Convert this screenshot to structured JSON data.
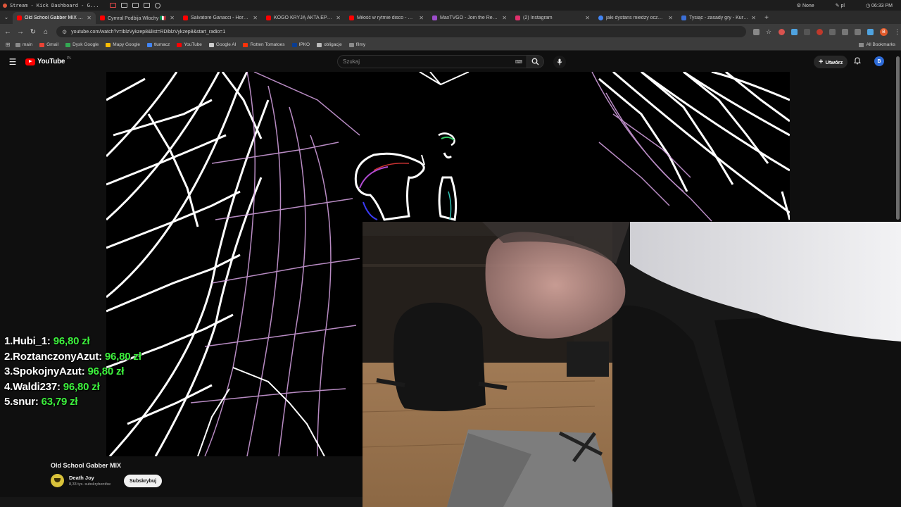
{
  "os": {
    "window_title": "Stream - Kick Dashboard - G...",
    "status_none": "None",
    "keyboard": "pl",
    "clock": "06:33 PM"
  },
  "tabs": [
    {
      "label": "Old School Gabber MIX - You",
      "color": "#ff0000",
      "active": true
    },
    {
      "label": "Cymrał Podbija Włochy 🇮🇹",
      "color": "#ff0000",
      "active": false
    },
    {
      "label": "Salvatore Ganacci - Horse (C",
      "color": "#ff0000",
      "active": false
    },
    {
      "label": "KOGO KRYJĄ AKTA EPSTEIN",
      "color": "#ff0000",
      "active": false
    },
    {
      "label": "Miłość w rytmie disco - Wład",
      "color": "#ff0000",
      "active": false
    },
    {
      "label": "MaxTVGO - Join the Revolu",
      "color": "#9b4dca",
      "active": false
    },
    {
      "label": "(2) Instagram",
      "color": "#e1306c",
      "active": false
    },
    {
      "label": "jaki dystans miedzy oczami",
      "color": "#4285f4",
      "active": false
    },
    {
      "label": "Tysiąc - zasady gry - Kurnik",
      "color": "#3b6fd6",
      "active": false
    }
  ],
  "address": {
    "url": "youtube.com/watch?v=iblzVykzep8&list=RDiblzVykzep8&start_radio=1"
  },
  "bookmarks": [
    {
      "label": "main",
      "color": "#8a8a8a"
    },
    {
      "label": "Gmail",
      "color": "#ea4335"
    },
    {
      "label": "Dysk Google",
      "color": "#34a853"
    },
    {
      "label": "Mapy Google",
      "color": "#fbbc04"
    },
    {
      "label": "tłumacz",
      "color": "#4285f4"
    },
    {
      "label": "YouTube",
      "color": "#ff0000"
    },
    {
      "label": "Google AI",
      "color": "#cccccc"
    },
    {
      "label": "Rotten Tomatoes",
      "color": "#fa320a"
    },
    {
      "label": "IPKO",
      "color": "#0a3d91"
    },
    {
      "label": "obligacje",
      "color": "#bbbbbb"
    },
    {
      "label": "filmy",
      "color": "#8a8a8a"
    }
  ],
  "bookmarks_all": "All Bookmarks",
  "youtube": {
    "logo": "YouTube",
    "region": "PL",
    "search_placeholder": "Szukaj",
    "create_label": "Utwórz",
    "avatar_letter": "B"
  },
  "leaderboard": [
    {
      "rank": "1.",
      "name": "Hubi_1:",
      "amount": "96,80 zł"
    },
    {
      "rank": "2.",
      "name": "RoztanczonyAzut:",
      "amount": "96,80 zł"
    },
    {
      "rank": "3.",
      "name": "SpokojnyAzut:",
      "amount": "96,80 zł"
    },
    {
      "rank": "4.",
      "name": "Waldi237:",
      "amount": "96,80 zł"
    },
    {
      "rank": "5.",
      "name": "snur:",
      "amount": "63,79 zł"
    }
  ],
  "video": {
    "title": "Old School Gabber MIX",
    "channel": "Death Joy",
    "subscribers": "8,33 tys. subskrybentów",
    "subscribe_label": "Subskrybuj"
  },
  "colors": {
    "accent_green": "#3df03d",
    "yt_red": "#ff0000"
  }
}
